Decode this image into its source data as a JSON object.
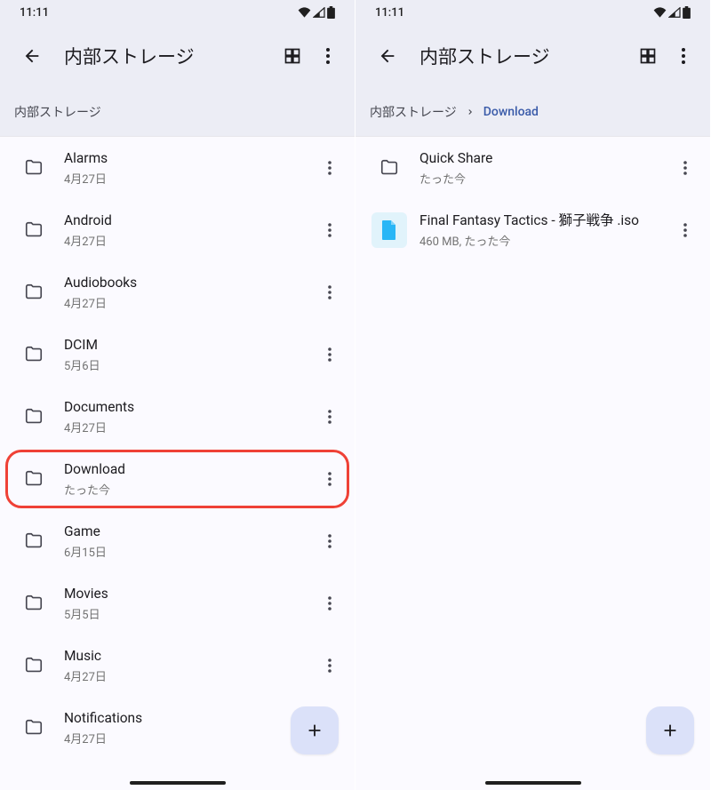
{
  "statusTime": "11:11",
  "left": {
    "title": "内部ストレージ",
    "breadcrumb": [
      {
        "label": "内部ストレージ",
        "active": false
      }
    ],
    "items": [
      {
        "type": "folder",
        "name": "Alarms",
        "meta": "4月27日",
        "highlight": false
      },
      {
        "type": "folder",
        "name": "Android",
        "meta": "4月27日",
        "highlight": false
      },
      {
        "type": "folder",
        "name": "Audiobooks",
        "meta": "4月27日",
        "highlight": false
      },
      {
        "type": "folder",
        "name": "DCIM",
        "meta": "5月6日",
        "highlight": false
      },
      {
        "type": "folder",
        "name": "Documents",
        "meta": "4月27日",
        "highlight": false
      },
      {
        "type": "folder",
        "name": "Download",
        "meta": "たった今",
        "highlight": true
      },
      {
        "type": "folder",
        "name": "Game",
        "meta": "6月15日",
        "highlight": false
      },
      {
        "type": "folder",
        "name": "Movies",
        "meta": "5月5日",
        "highlight": false
      },
      {
        "type": "folder",
        "name": "Music",
        "meta": "4月27日",
        "highlight": false
      },
      {
        "type": "folder",
        "name": "Notifications",
        "meta": "4月27日",
        "highlight": false
      }
    ]
  },
  "right": {
    "title": "内部ストレージ",
    "breadcrumb": [
      {
        "label": "内部ストレージ",
        "active": false
      },
      {
        "label": "Download",
        "active": true
      }
    ],
    "items": [
      {
        "type": "folder",
        "name": "Quick Share",
        "meta": "たった今",
        "highlight": false
      },
      {
        "type": "file",
        "name": "Final Fantasy Tactics - 獅子戦争 .iso",
        "meta": "460 MB, たった今",
        "highlight": false
      }
    ]
  }
}
